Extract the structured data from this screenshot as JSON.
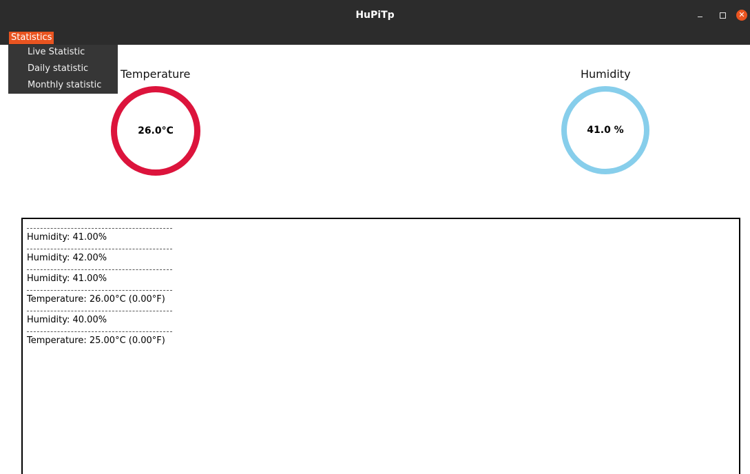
{
  "window": {
    "title": "HuPiTp",
    "close_glyph": "✕"
  },
  "menubar": {
    "statistics_label": "Statistics"
  },
  "dropdown": {
    "items": [
      "Live Statistic",
      "Daily statistic",
      "Monthly statistic"
    ]
  },
  "temperature": {
    "label": "Temperature",
    "value": "26.0°C",
    "color": "#dc143c"
  },
  "humidity": {
    "label": "Humidity",
    "value": "41.0 %",
    "color": "#87ceeb"
  },
  "log": {
    "separator": "--------------------------------------------",
    "entries": [
      "Humidity: 41.00%",
      "Humidity: 42.00%",
      "Humidity: 41.00%",
      "Temperature: 26.00°C (0.00°F)",
      "Humidity: 40.00%",
      "Temperature: 25.00°C (0.00°F)"
    ]
  },
  "colors": {
    "titlebar": "#2c2c2c",
    "accent": "#e95420",
    "menu_bg": "#363636"
  },
  "icons": {
    "minimize": "minimize-icon",
    "maximize": "maximize-icon",
    "close": "close-icon"
  }
}
